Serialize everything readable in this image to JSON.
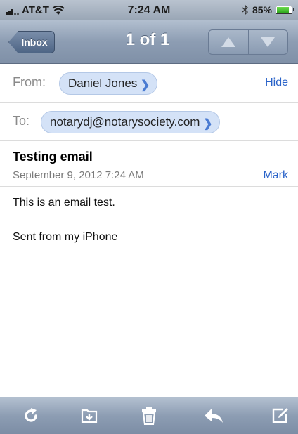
{
  "status_bar": {
    "carrier": "AT&T",
    "time": "7:24 AM",
    "battery_percent": "85%",
    "battery_level": 0.85,
    "wifi_icon": "wifi-icon",
    "bluetooth_icon": "bluetooth-icon"
  },
  "nav": {
    "back_label": "Inbox",
    "title": "1 of 1"
  },
  "header": {
    "from_label": "From:",
    "from_name": "Daniel Jones",
    "hide_label": "Hide",
    "to_label": "To:",
    "to_address": "notarydj@notarysociety.com",
    "subject": "Testing email",
    "date": "September 9, 2012 7:24 AM",
    "mark_label": "Mark"
  },
  "body": {
    "line1": "This is an email test.",
    "line2": "Sent from my iPhone"
  },
  "toolbar": {
    "icons": [
      "refresh-icon",
      "move-folder-icon",
      "trash-icon",
      "reply-icon",
      "compose-icon"
    ]
  },
  "colors": {
    "link": "#2a63c9",
    "pill_bg": "#d4e2f7",
    "bar": "#8d9db3"
  }
}
